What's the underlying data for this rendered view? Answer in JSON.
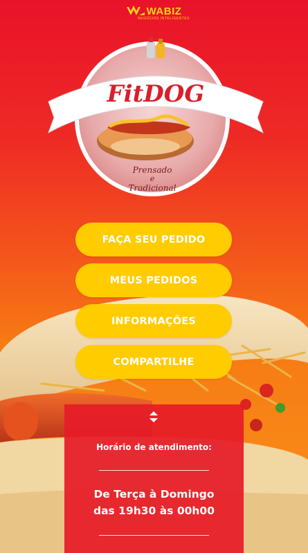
{
  "brand": {
    "name": "WABIZ",
    "tagline": "NEGÓCIOS INTELIGENTES"
  },
  "logo": {
    "title": "FitDOG",
    "line1": "Prensado",
    "line2": "e",
    "line3": "Tradicional"
  },
  "menu": {
    "order": "FAÇA SEU PEDIDO",
    "my_orders": "MEUS PEDIDOS",
    "info": "INFORMAÇÕES",
    "share": "COMPARTILHE"
  },
  "hours": {
    "label": "Horário de atendimento:",
    "days": "De Terça à Domingo",
    "time": "das 19h30 às 00h00"
  },
  "colors": {
    "button": "#ffcc00",
    "panel": "#e61c28",
    "brand": "#ffd21a"
  }
}
